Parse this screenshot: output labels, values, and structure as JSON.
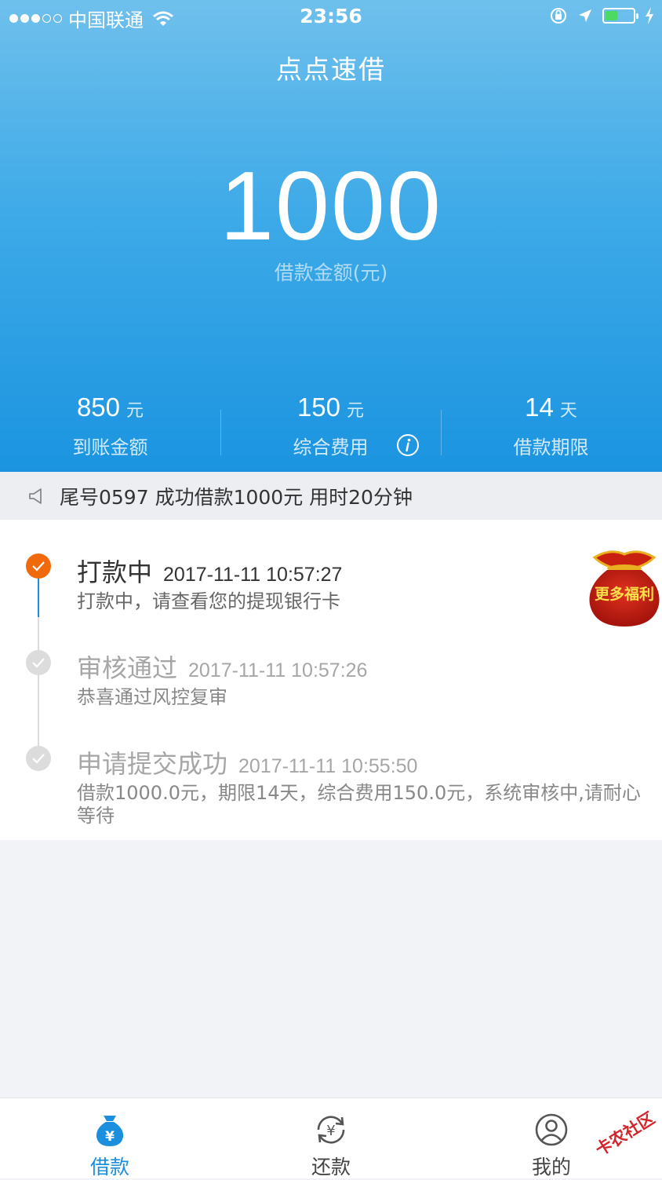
{
  "status_bar": {
    "carrier": "中国联通",
    "time": "23:56",
    "battery_level": 0.45,
    "battery_color": "#4cd964"
  },
  "header": {
    "title": "点点速借",
    "amount": "1000",
    "amount_label": "借款金额(元)"
  },
  "stats": [
    {
      "value": "850",
      "unit": "元",
      "label": "到账金额"
    },
    {
      "value": "150",
      "unit": "元",
      "label": "综合费用",
      "icon": "info-icon"
    },
    {
      "value": "14",
      "unit": "天",
      "label": "借款期限"
    }
  ],
  "notice": {
    "icon": "speaker-icon",
    "text": "尾号0597 成功借款1000元 用时20分钟"
  },
  "timeline": [
    {
      "title": "打款中",
      "time": "2017-11-11 10:57:27",
      "desc": "打款中，请查看您的提现银行卡",
      "state": "active"
    },
    {
      "title": "审核通过",
      "time": "2017-11-11 10:57:26",
      "desc": "恭喜通过风控复审",
      "state": "done"
    },
    {
      "title": "申请提交成功",
      "time": "2017-11-11 10:55:50",
      "desc_line1": "借款1000.0元，期限14天，综合费用150.0元，系统审核中,请耐心",
      "desc_line2": "等待",
      "state": "done"
    }
  ],
  "promo": {
    "label": "更多福利"
  },
  "tabbar": [
    {
      "label": "借款",
      "icon": "loan-bag-icon",
      "active": true
    },
    {
      "label": "还款",
      "icon": "repay-refresh-icon",
      "active": false
    },
    {
      "label": "我的",
      "icon": "user-icon",
      "active": false
    }
  ],
  "watermark": "卡农社区",
  "colors": {
    "accent": "#1b8fde",
    "active_step": "#f06a0c",
    "hero_top": "#6fc0ec",
    "hero_bottom": "#1b94e0"
  }
}
